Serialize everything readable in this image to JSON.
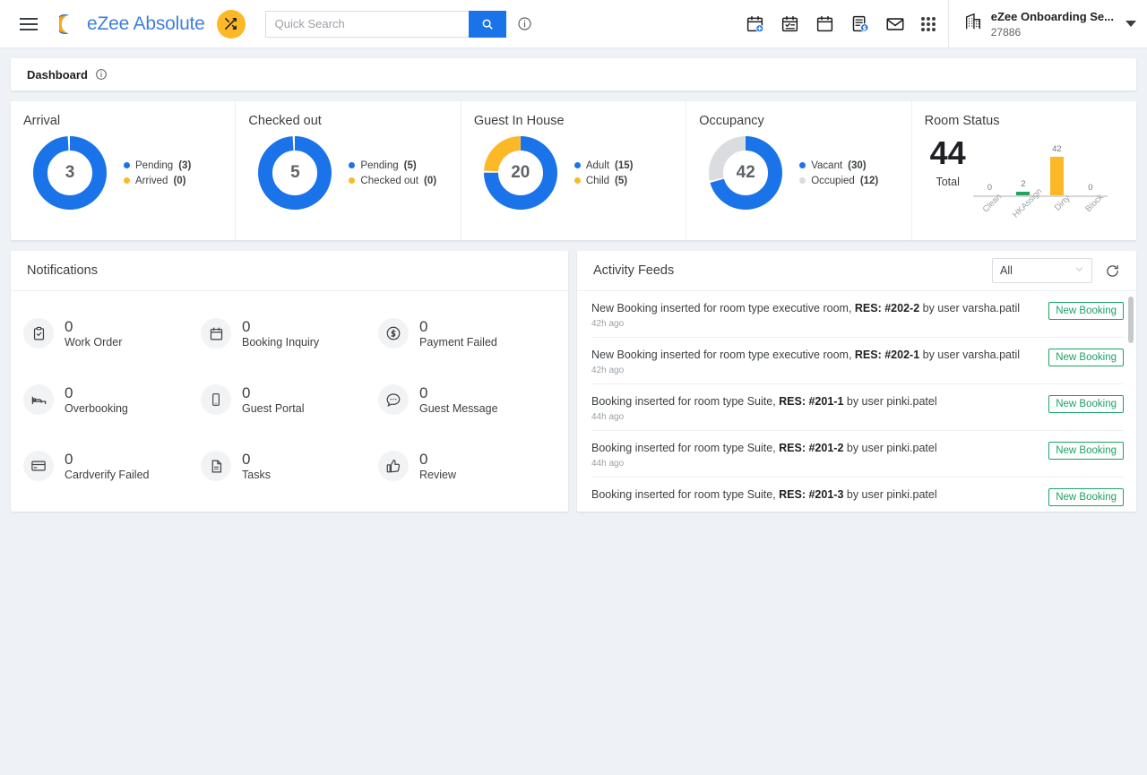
{
  "header": {
    "menu_icon": "hamburger-icon",
    "brand": "eZee Absolute",
    "shuffle_icon": "shuffle-icon",
    "search": {
      "value": "",
      "placeholder": "Quick Search",
      "icon": "search-icon"
    },
    "info_icon": "info-icon",
    "icons": [
      {
        "name": "calendar-add-icon"
      },
      {
        "name": "calendar-checklist-icon"
      },
      {
        "name": "calendar-icon"
      },
      {
        "name": "invoice-dollar-icon"
      },
      {
        "name": "mail-icon"
      },
      {
        "name": "apps-grid-icon"
      }
    ],
    "property": {
      "icon": "building-icon",
      "name": "eZee Onboarding Se...",
      "id": "27886",
      "caret": "caret-down-icon"
    }
  },
  "breadcrumb": {
    "title": "Dashboard",
    "info_icon": "info-icon"
  },
  "stat_cards": [
    {
      "title": "Arrival",
      "center": "3",
      "legend": [
        {
          "label": "Pending",
          "value": "(3)",
          "color": "#1a73e8"
        },
        {
          "label": "Arrived",
          "value": "(0)",
          "color": "#fcb827"
        }
      ]
    },
    {
      "title": "Checked out",
      "center": "5",
      "legend": [
        {
          "label": "Pending",
          "value": "(5)",
          "color": "#1a73e8"
        },
        {
          "label": "Checked out",
          "value": "(0)",
          "color": "#fcb827"
        }
      ]
    },
    {
      "title": "Guest In House",
      "center": "20",
      "legend": [
        {
          "label": "Adult",
          "value": "(15)",
          "color": "#1a73e8"
        },
        {
          "label": "Child",
          "value": "(5)",
          "color": "#fcb827"
        }
      ]
    },
    {
      "title": "Occupancy",
      "center": "42",
      "legend": [
        {
          "label": "Vacant",
          "value": "(30)",
          "color": "#1a73e8"
        },
        {
          "label": "Occupied",
          "value": "(12)",
          "color": "#dadce0"
        }
      ]
    }
  ],
  "room_status": {
    "title": "Room Status",
    "total": "44",
    "total_label": "Total"
  },
  "chart_data": [
    {
      "type": "pie",
      "title": "Arrival",
      "labels": [
        "Pending",
        "Arrived"
      ],
      "values": [
        3,
        0
      ],
      "colors": [
        "#1a73e8",
        "#fcb827"
      ],
      "center_value": 3,
      "legend": "right"
    },
    {
      "type": "pie",
      "title": "Checked out",
      "labels": [
        "Pending",
        "Checked out"
      ],
      "values": [
        5,
        0
      ],
      "colors": [
        "#1a73e8",
        "#fcb827"
      ],
      "center_value": 5,
      "legend": "right"
    },
    {
      "type": "pie",
      "title": "Guest In House",
      "labels": [
        "Adult",
        "Child"
      ],
      "values": [
        15,
        5
      ],
      "colors": [
        "#1a73e8",
        "#fcb827"
      ],
      "center_value": 20,
      "legend": "right"
    },
    {
      "type": "pie",
      "title": "Occupancy",
      "labels": [
        "Vacant",
        "Occupied"
      ],
      "values": [
        30,
        12
      ],
      "colors": [
        "#1a73e8",
        "#dadce0"
      ],
      "center_value": 42,
      "legend": "right"
    },
    {
      "type": "bar",
      "title": "Room Status",
      "categories": [
        "Clean",
        "HKAssign",
        "Dirty",
        "Block"
      ],
      "values": [
        0,
        2,
        42,
        0
      ],
      "colors": [
        "#fcb827",
        "#22a45d",
        "#fcb827",
        "#fcb827"
      ],
      "total": 44,
      "xlabel": "",
      "ylabel": "",
      "ylim": [
        0,
        44
      ],
      "grid": false,
      "data_labels": true
    }
  ],
  "notifications": {
    "title": "Notifications",
    "items": [
      {
        "count": "0",
        "label": "Work Order",
        "icon": "clipboard-check-icon"
      },
      {
        "count": "0",
        "label": "Booking Inquiry",
        "icon": "calendar-icon"
      },
      {
        "count": "0",
        "label": "Payment Failed",
        "icon": "dollar-circle-icon"
      },
      {
        "count": "0",
        "label": "Overbooking",
        "icon": "bed-icon"
      },
      {
        "count": "0",
        "label": "Guest Portal",
        "icon": "mobile-icon"
      },
      {
        "count": "0",
        "label": "Guest Message",
        "icon": "chat-bubble-icon"
      },
      {
        "count": "0",
        "label": "Cardverify Failed",
        "icon": "credit-card-icon"
      },
      {
        "count": "0",
        "label": "Tasks",
        "icon": "document-icon"
      },
      {
        "count": "0",
        "label": "Review",
        "icon": "thumbs-up-icon"
      }
    ]
  },
  "activity_feeds": {
    "title": "Activity Feeds",
    "filter": {
      "value": "All",
      "options": [
        "All"
      ],
      "chevron": "chevron-down-icon"
    },
    "refresh_icon": "refresh-icon",
    "items": [
      {
        "prefix": "New Booking inserted for room type executive room, ",
        "res": "RES: #202-2",
        "suffix": " by user varsha.patil",
        "time": "42h ago",
        "badge": "New Booking"
      },
      {
        "prefix": "New Booking inserted for room type executive room, ",
        "res": "RES: #202-1",
        "suffix": " by user varsha.patil",
        "time": "42h ago",
        "badge": "New Booking"
      },
      {
        "prefix": "Booking inserted for room type Suite, ",
        "res": "RES: #201-1",
        "suffix": " by user pinki.patel",
        "time": "44h ago",
        "badge": "New Booking"
      },
      {
        "prefix": "Booking inserted for room type Suite, ",
        "res": "RES: #201-2",
        "suffix": " by user pinki.patel",
        "time": "44h ago",
        "badge": "New Booking"
      },
      {
        "prefix": "Booking inserted for room type Suite, ",
        "res": "RES: #201-3",
        "suffix": " by user pinki.patel",
        "time": "",
        "badge": "New Booking"
      }
    ]
  },
  "colors": {
    "accent_blue": "#1a73e8",
    "accent_yellow": "#fcb827",
    "accent_green": "#1aa363",
    "grey": "#dadce0",
    "page_bg": "#eef1f5"
  }
}
